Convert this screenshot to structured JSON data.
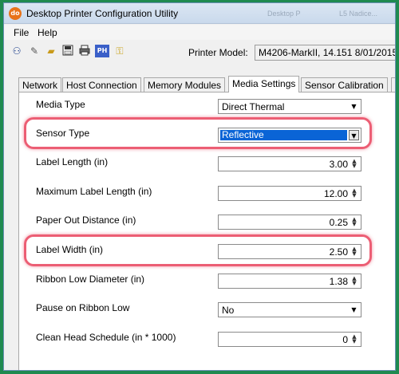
{
  "window": {
    "title": "Desktop Printer Configuration Utility",
    "app_icon_text": "do",
    "background_title_fragments": [
      "Desktop P",
      "L5 Nadice..."
    ]
  },
  "menu": {
    "items": [
      {
        "label": "File"
      },
      {
        "label": "Help"
      }
    ]
  },
  "toolbar": {
    "icons": [
      "connect-icon",
      "wrench-icon",
      "open-folder-icon",
      "save-icon",
      "print-icon",
      "ph-icon",
      "key-icon"
    ],
    "ph_label": "PH",
    "printer_model_label": "Printer Model:",
    "printer_model_value": "M4206-MarkII, 14.151 8/01/2015"
  },
  "tabs": [
    {
      "label": "Network",
      "active": false
    },
    {
      "label": "Host Connection",
      "active": false
    },
    {
      "label": "Memory Modules",
      "active": false
    },
    {
      "label": "Media Settings",
      "active": true
    },
    {
      "label": "Sensor Calibration",
      "active": false
    },
    {
      "label": "S",
      "active": false
    }
  ],
  "media_settings": {
    "media_type": {
      "label": "Media Type",
      "value": "Direct Thermal"
    },
    "sensor_type": {
      "label": "Sensor Type",
      "value": "Reflective"
    },
    "label_length": {
      "label": "Label Length (in)",
      "value": "3.00"
    },
    "max_label_length": {
      "label": "Maximum Label Length (in)",
      "value": "12.00"
    },
    "paper_out_distance": {
      "label": "Paper Out Distance (in)",
      "value": "0.25"
    },
    "label_width": {
      "label": "Label Width (in)",
      "value": "2.50"
    },
    "ribbon_low_diameter": {
      "label": "Ribbon Low Diameter (in)",
      "value": "1.38"
    },
    "pause_on_ribbon_low": {
      "label": "Pause on Ribbon Low",
      "value": "No"
    },
    "clean_head_schedule": {
      "label": "Clean Head Schedule (in * 1000)",
      "value": "0"
    }
  },
  "colors": {
    "highlight": "#e62846",
    "selection": "#0a64d6",
    "frame": "#1f8a50"
  }
}
